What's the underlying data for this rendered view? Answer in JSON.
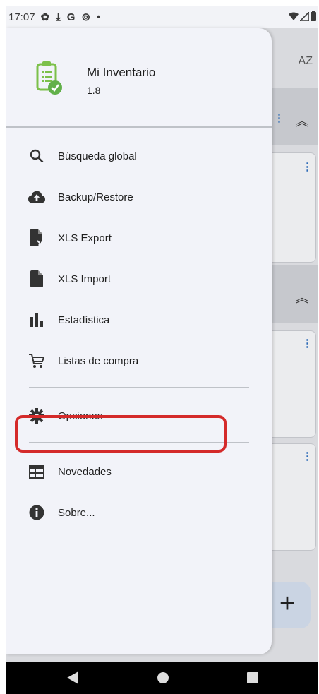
{
  "status_bar": {
    "time": "17:07",
    "icons": [
      "gear-icon",
      "download-icon",
      "google-icon",
      "sync-icon",
      "dot-icon"
    ],
    "right_icons": [
      "wifi-icon",
      "signal-icon",
      "battery-icon"
    ]
  },
  "background": {
    "sort_label": "AZ"
  },
  "drawer": {
    "app_name": "Mi Inventario",
    "app_version": "1.8",
    "items": [
      {
        "label": "Búsqueda global",
        "icon": "search-icon"
      },
      {
        "label": "Backup/Restore",
        "icon": "cloud-upload-icon"
      },
      {
        "label": "XLS Export",
        "icon": "file-export-icon"
      },
      {
        "label": "XLS Import",
        "icon": "file-icon"
      },
      {
        "label": "Estadística",
        "icon": "bar-chart-icon"
      },
      {
        "label": "Listas de compra",
        "icon": "cart-icon"
      },
      {
        "label": "Opciones",
        "icon": "gear-icon"
      },
      {
        "label": "Novedades",
        "icon": "news-icon"
      },
      {
        "label": "Sobre...",
        "icon": "info-icon"
      }
    ]
  },
  "colors": {
    "accent_green": "#7cc04a",
    "highlight_red": "#d42a2a",
    "drawer_bg": "#f2f3f9"
  },
  "nav_bar": {
    "buttons": [
      "back-icon",
      "home-icon",
      "recents-icon"
    ]
  }
}
